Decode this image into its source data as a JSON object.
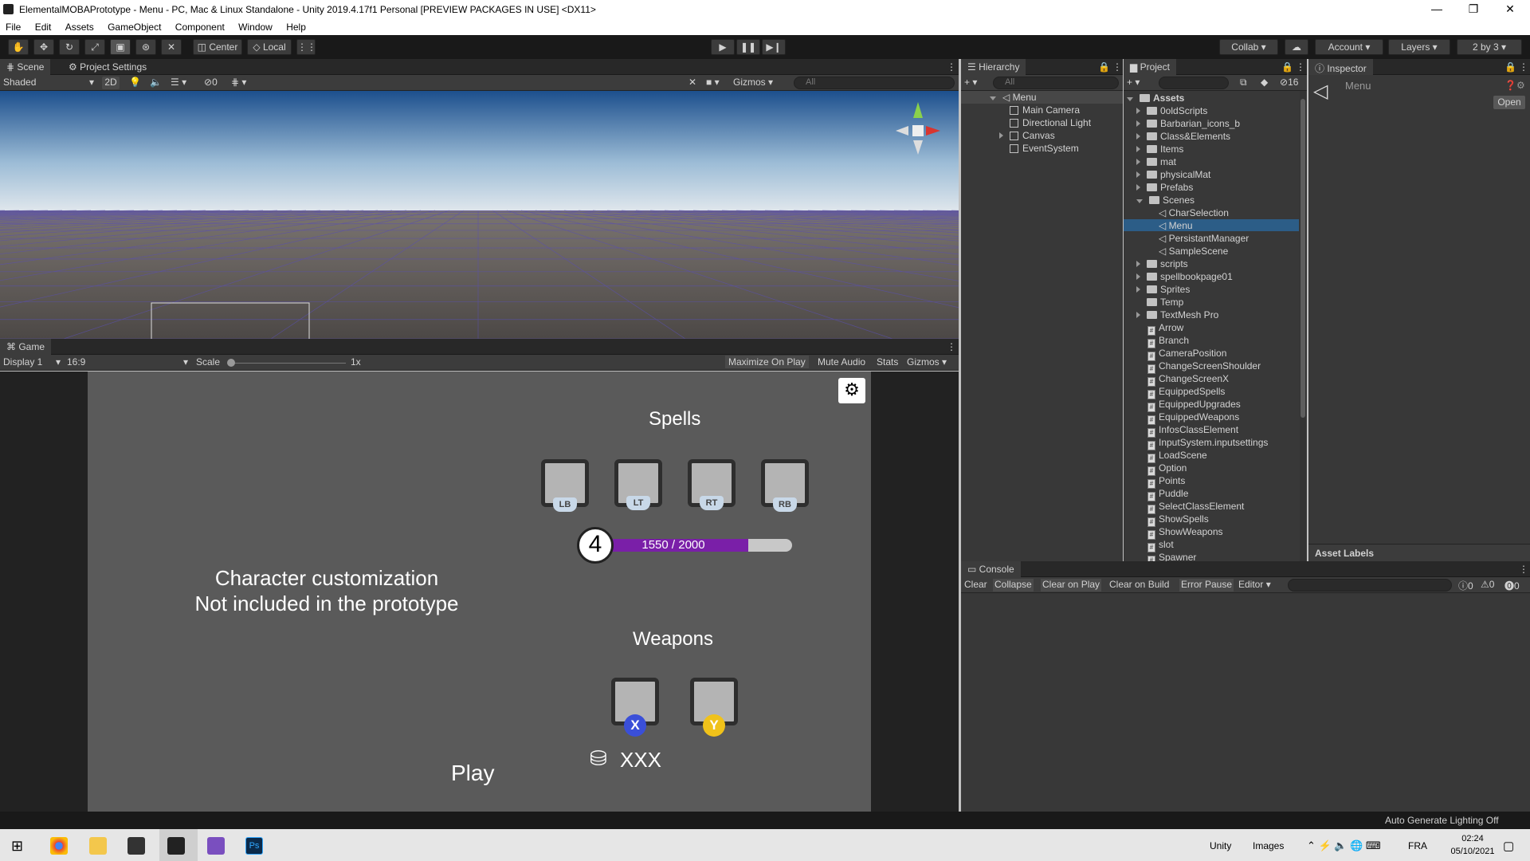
{
  "window": {
    "title": "ElementalMOBAPrototype - Menu - PC, Mac & Linux Standalone - Unity 2019.4.17f1 Personal [PREVIEW PACKAGES IN USE] <DX11>",
    "minimize": "—",
    "maximize": "❐",
    "close": "✕"
  },
  "menu": [
    "File",
    "Edit",
    "Assets",
    "GameObject",
    "Component",
    "Window",
    "Help"
  ],
  "toolbar": {
    "center": "Center",
    "local": "Local",
    "collab": "Collab",
    "account": "Account",
    "layers": "Layers",
    "layout": "2 by 3"
  },
  "scene": {
    "tab_scene": "Scene",
    "tab_project_settings": "Project Settings",
    "shading": "Shaded",
    "mode_2d": "2D",
    "hidden_count": "0",
    "gizmos": "Gizmos",
    "search_placeholder": "All"
  },
  "game": {
    "tab": "Game",
    "display": "Display 1",
    "aspect": "16:9",
    "scale_label": "Scale",
    "scale_value": "1x",
    "maximize_on_play": "Maximize On Play",
    "mute_audio": "Mute Audio",
    "stats": "Stats",
    "gizmos": "Gizmos",
    "ui": {
      "spells_title": "Spells",
      "spell_slots": [
        "LB",
        "LT",
        "RT",
        "RB"
      ],
      "level": "4",
      "xp_text": "1550 / 2000",
      "xp_fraction": 0.775,
      "customization_line1": "Character customization",
      "customization_line2": "Not included in the prototype",
      "weapons_title": "Weapons",
      "weapon_buttons": [
        "X",
        "Y"
      ],
      "currency": "XXX",
      "play": "Play"
    }
  },
  "hierarchy": {
    "tab": "Hierarchy",
    "search_placeholder": "All",
    "root": "Menu",
    "items": [
      "Main Camera",
      "Directional Light",
      "Canvas",
      "EventSystem"
    ]
  },
  "project": {
    "tab": "Project",
    "hidden_count": "16",
    "root": "Assets",
    "folders": [
      "0oldScripts",
      "Barbarian_icons_b",
      "Class&Elements",
      "Items",
      "mat",
      "physicalMat",
      "Prefabs"
    ],
    "scenes_folder": "Scenes",
    "scenes": [
      "CharSelection",
      "Menu",
      "PersistantManager",
      "SampleScene"
    ],
    "selected_scene": "Menu",
    "more_folders": [
      "scripts",
      "spellbookpage01",
      "Sprites",
      "Temp",
      "TextMesh Pro"
    ],
    "files": [
      "Arrow",
      "Branch",
      "CameraPosition",
      "ChangeScreenShoulder",
      "ChangeScreenX",
      "EquippedSpells",
      "EquippedUpgrades",
      "EquippedWeapons",
      "InfosClassElement",
      "InputSystem.inputsettings",
      "LoadScene",
      "Option",
      "Points",
      "Puddle",
      "SelectClassElement",
      "ShowSpells",
      "ShowWeapons",
      "slot",
      "Spawner"
    ]
  },
  "inspector": {
    "tab": "Inspector",
    "object": "Menu",
    "open": "Open",
    "asset_labels": "Asset Labels"
  },
  "console": {
    "tab": "Console",
    "buttons": [
      "Clear",
      "Collapse",
      "Clear on Play",
      "Clear on Build",
      "Error Pause",
      "Editor"
    ],
    "log_count": "0",
    "warn_count": "0",
    "error_count": "0"
  },
  "status": {
    "lighting": "Auto Generate Lighting Off"
  },
  "taskbar": {
    "unity_label": "Unity",
    "images_label": "Images",
    "language": "FRA",
    "time": "02:24",
    "date": "05/10/2021"
  }
}
